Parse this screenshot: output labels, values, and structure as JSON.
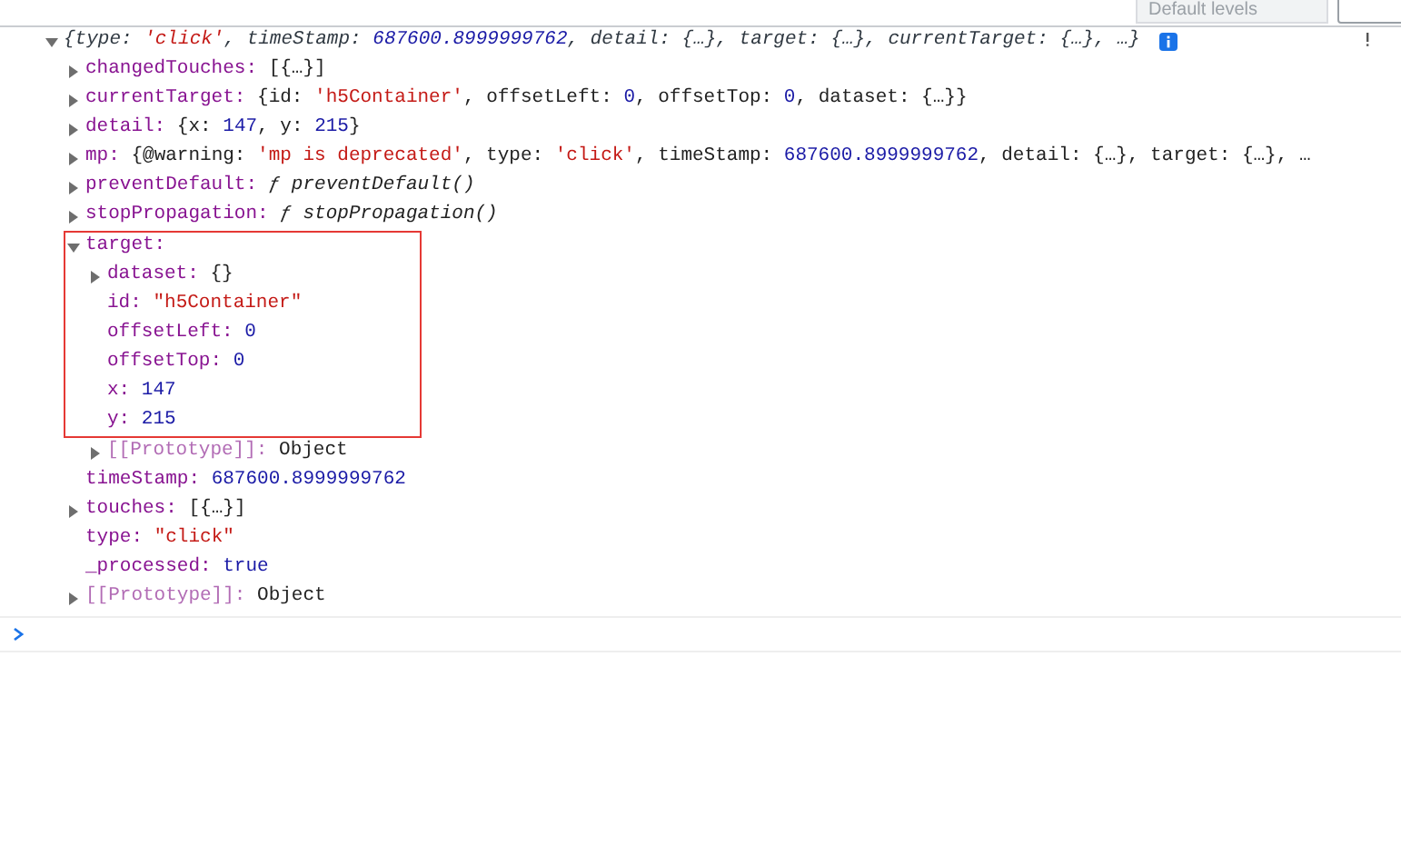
{
  "toolbar": {
    "level_filter": "Default levels"
  },
  "message": {
    "expanded": true,
    "summary": [
      {
        "kind": "text",
        "text": "{type: "
      },
      {
        "kind": "string",
        "text": "'click'"
      },
      {
        "kind": "text",
        "text": ", timeStamp: "
      },
      {
        "kind": "number",
        "text": "687600.8999999762"
      },
      {
        "kind": "text",
        "text": ", detail: {…}, target: {…}, currentTarget: {…}, …}"
      }
    ],
    "properties": [
      {
        "key": "changedTouches:",
        "kind": "property",
        "expanded": false,
        "boxed": false,
        "value": [
          {
            "kind": "punct",
            "text": "[{…}]"
          }
        ]
      },
      {
        "key": "currentTarget:",
        "kind": "property",
        "expanded": false,
        "boxed": false,
        "value": [
          {
            "kind": "punct",
            "text": "{id: "
          },
          {
            "kind": "string",
            "text": "'h5Container'"
          },
          {
            "kind": "punct",
            "text": ", offsetLeft: "
          },
          {
            "kind": "number",
            "text": "0"
          },
          {
            "kind": "punct",
            "text": ", offsetTop: "
          },
          {
            "kind": "number",
            "text": "0"
          },
          {
            "kind": "punct",
            "text": ", dataset: {…}}"
          }
        ]
      },
      {
        "key": "detail:",
        "kind": "property",
        "expanded": false,
        "boxed": false,
        "value": [
          {
            "kind": "punct",
            "text": "{x: "
          },
          {
            "kind": "number",
            "text": "147"
          },
          {
            "kind": "punct",
            "text": ", y: "
          },
          {
            "kind": "number",
            "text": "215"
          },
          {
            "kind": "punct",
            "text": "}"
          }
        ]
      },
      {
        "key": "mp:",
        "kind": "property",
        "expanded": false,
        "boxed": false,
        "value": [
          {
            "kind": "punct",
            "text": "{@warning: "
          },
          {
            "kind": "string",
            "text": "'mp is deprecated'"
          },
          {
            "kind": "punct",
            "text": ", type: "
          },
          {
            "kind": "string",
            "text": "'click'"
          },
          {
            "kind": "punct",
            "text": ", timeStamp: "
          },
          {
            "kind": "number",
            "text": "687600.8999999762"
          },
          {
            "kind": "punct",
            "text": ", detail: {…}, target: {…}, …"
          }
        ]
      },
      {
        "key": "preventDefault:",
        "kind": "property",
        "expanded": false,
        "boxed": false,
        "value": [
          {
            "kind": "function",
            "text": "ƒ preventDefault()"
          }
        ]
      },
      {
        "key": "stopPropagation:",
        "kind": "property",
        "expanded": false,
        "boxed": false,
        "value": [
          {
            "kind": "function",
            "text": "ƒ stopPropagation()"
          }
        ]
      },
      {
        "key": "target:",
        "kind": "property",
        "expanded": true,
        "boxed": true,
        "children": [
          {
            "key": "dataset:",
            "kind": "property",
            "expanded": false,
            "boxed": true,
            "value": [
              {
                "kind": "punct",
                "text": "{}"
              }
            ]
          },
          {
            "key": "id:",
            "kind": "property",
            "boxed": true,
            "value": [
              {
                "kind": "string",
                "text": "\"h5Container\""
              }
            ]
          },
          {
            "key": "offsetLeft:",
            "kind": "property",
            "boxed": true,
            "value": [
              {
                "kind": "number",
                "text": "0"
              }
            ]
          },
          {
            "key": "offsetTop:",
            "kind": "property",
            "boxed": true,
            "value": [
              {
                "kind": "number",
                "text": "0"
              }
            ]
          },
          {
            "key": "x:",
            "kind": "property",
            "boxed": true,
            "value": [
              {
                "kind": "number",
                "text": "147"
              }
            ]
          },
          {
            "key": "y:",
            "kind": "property",
            "boxed": true,
            "value": [
              {
                "kind": "number",
                "text": "215"
              }
            ]
          },
          {
            "key": "[[Prototype]]:",
            "kind": "internal",
            "expanded": false,
            "boxed": false,
            "value": [
              {
                "kind": "punct",
                "text": "Object"
              }
            ]
          }
        ]
      },
      {
        "key": "timeStamp:",
        "kind": "property",
        "boxed": false,
        "value": [
          {
            "kind": "number",
            "text": "687600.8999999762"
          }
        ]
      },
      {
        "key": "touches:",
        "kind": "property",
        "expanded": false,
        "boxed": false,
        "value": [
          {
            "kind": "punct",
            "text": "[{…}]"
          }
        ]
      },
      {
        "key": "type:",
        "kind": "property",
        "boxed": false,
        "value": [
          {
            "kind": "string",
            "text": "\"click\""
          }
        ]
      },
      {
        "key": "_processed:",
        "kind": "property",
        "boxed": false,
        "value": [
          {
            "kind": "number",
            "text": "true"
          }
        ]
      },
      {
        "key": "[[Prototype]]:",
        "kind": "internal",
        "expanded": false,
        "boxed": false,
        "value": [
          {
            "kind": "punct",
            "text": "Object"
          }
        ]
      }
    ]
  }
}
